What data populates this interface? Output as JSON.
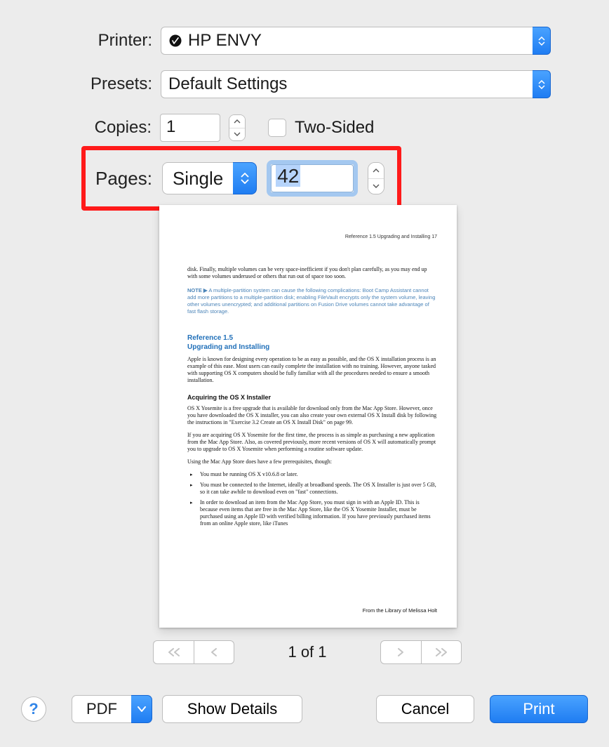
{
  "labels": {
    "printer": "Printer:",
    "presets": "Presets:",
    "copies": "Copies:",
    "two_sided": "Two-Sided",
    "pages": "Pages:"
  },
  "printer": {
    "name": "HP ENVY"
  },
  "presets": {
    "value": "Default Settings"
  },
  "copies": {
    "value": "1"
  },
  "two_sided": {
    "checked": false
  },
  "pages": {
    "mode": "Single",
    "number": "42"
  },
  "preview": {
    "header": "Reference 1.5 Upgrading and Installing   17",
    "lead": "disk. Finally, multiple volumes can be very space-inefficient if you don't plan carefully, as you may end up with some volumes underused or others that run out of space too soon.",
    "note_label": "NOTE ▶",
    "note_body": "A multiple-partition system can cause the following complications: Boot Camp Assistant cannot add more partitions to a multiple-partition disk; enabling FileVault encrypts only the system volume, leaving other volumes unencrypted; and additional partitions on Fusion Drive volumes cannot take advantage of fast flash storage.",
    "section_num": "Reference 1.5",
    "section_title": "Upgrading and Installing",
    "section_body": "Apple is known for designing every operation to be as easy as possible, and the OS X installation process is an example of this ease. Most users can easily complete the installation with no training. However, anyone tasked with supporting OS X computers should be fully familiar with all the procedures needed to ensure a smooth installation.",
    "sub_head": "Acquiring the OS X Installer",
    "sub_p1": "OS X Yosemite is a free upgrade that is available for download only from the Mac App Store. However, once you have downloaded the OS X installer, you can also create your own external OS X Install disk by following the instructions in \"Exercise 3.2 Create an OS X Install Disk\" on page 99.",
    "sub_p2": "If you are acquiring OS X Yosemite for the first time, the process is as simple as purchasing a new application from the Mac App Store. Also, as covered previously, more recent versions of OS X will automatically prompt you to upgrade to OS X Yosemite when performing a routine software update.",
    "sub_p3": "Using the Mac App Store does have a few prerequisites, though:",
    "bullets": [
      "You must be running OS X v10.6.8 or later.",
      "You must be connected to the Internet, ideally at broadband speeds. The OS X Installer is just over 5 GB, so it can take awhile to download even on \"fast\" connections.",
      "In order to download an item from the Mac App Store, you must sign in with an Apple ID. This is because even items that are free in the Mac App Store, like the OS X Yosemite Installer, must be purchased using an Apple ID with verified billing information. If you have previously purchased items from an online Apple store, like iTunes"
    ],
    "footer": "From the Library of Melissa Holt"
  },
  "nav": {
    "page_indicator": "1 of 1"
  },
  "bottom": {
    "help": "?",
    "pdf": "PDF",
    "show_details": "Show Details",
    "cancel": "Cancel",
    "print": "Print"
  }
}
